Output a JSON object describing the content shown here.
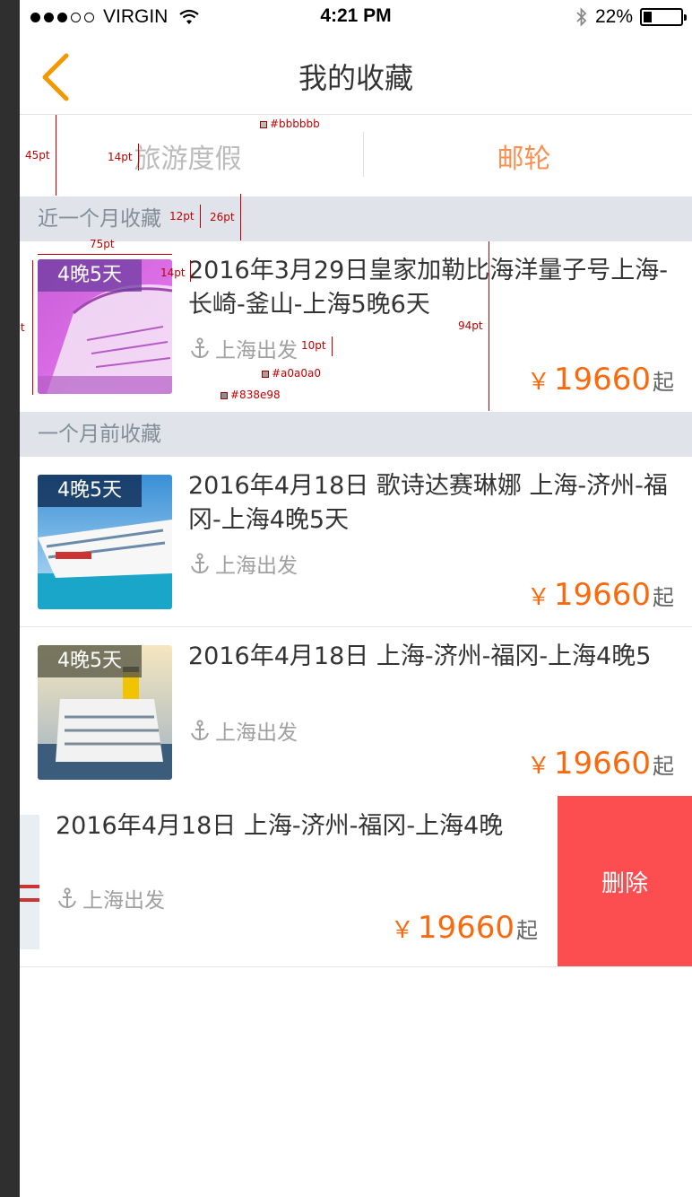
{
  "status": {
    "carrier": "VIRGIN",
    "time": "4:21 PM",
    "battery": "22%",
    "battery_level": 0.22
  },
  "nav": {
    "title": "我的收藏"
  },
  "tabs": [
    {
      "label": "旅游度假",
      "state": "inactive"
    },
    {
      "label": "邮轮",
      "state": "active"
    }
  ],
  "sections": {
    "recent": "近一个月收藏",
    "older": "一个月前收藏"
  },
  "items": [
    {
      "nights": "4晚5天",
      "title": "2016年3月29日皇家加勒比海洋量子号上海-长崎-釜山-上海5晚6天",
      "depart": "上海出发",
      "yen": "￥",
      "price": "19660",
      "suffix": "起"
    },
    {
      "nights": "4晚5天",
      "title": "2016年4月18日 歌诗达赛琳娜 上海-济州-福冈-上海4晚5天",
      "depart": "上海出发",
      "yen": "￥",
      "price": "19660",
      "suffix": "起"
    },
    {
      "nights": "4晚5天",
      "title": "2016年4月18日 上海-济州-福冈-上海4晚5",
      "depart": "上海出发",
      "yen": "￥",
      "price": "19660",
      "suffix": "起"
    },
    {
      "title": "2016年4月18日 上海-济州-福冈-上海4晚",
      "depart": "上海出发",
      "yen": "￥",
      "price": "19660",
      "suffix": "起"
    }
  ],
  "delete_label": "删除",
  "annotations": {
    "color_tab": "#bbbbbb",
    "color_depart": "#a0a0a0",
    "color_section": "#838e98",
    "h45": "45pt",
    "h14a": "14pt",
    "h12": "12pt",
    "h26": "26pt",
    "w75": "75pt",
    "h75": "75pt",
    "h14b": "14pt",
    "h10": "10pt",
    "h94": "94pt"
  },
  "colors": {
    "accent": "#fc8f4f",
    "price": "#f96a0e",
    "delete": "#fc4e50",
    "back": "#f39800"
  }
}
